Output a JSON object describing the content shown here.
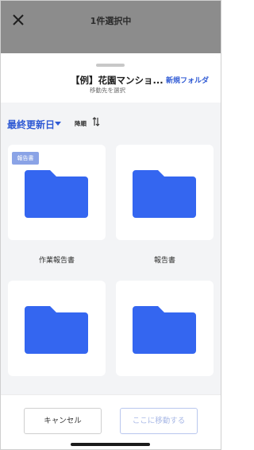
{
  "header": {
    "title": "1件選択中"
  },
  "sheet": {
    "title": "【例】花園マンショ...",
    "subtitle": "移動先を選択",
    "new_folder_label": "新規フォルダ"
  },
  "sort": {
    "label": "最終更新日",
    "order_label": "降順"
  },
  "folders": [
    {
      "name": "",
      "badge": "報告書"
    },
    {
      "name": ""
    },
    {
      "name": "作業報告書"
    },
    {
      "name": "報告書"
    },
    {
      "name": ""
    },
    {
      "name": ""
    }
  ],
  "footer": {
    "cancel_label": "キャンセル",
    "move_label": "ここに移動する"
  },
  "colors": {
    "accent": "#2f5ad4",
    "folder": "#3466f0",
    "badge": "#8aa3e6"
  }
}
